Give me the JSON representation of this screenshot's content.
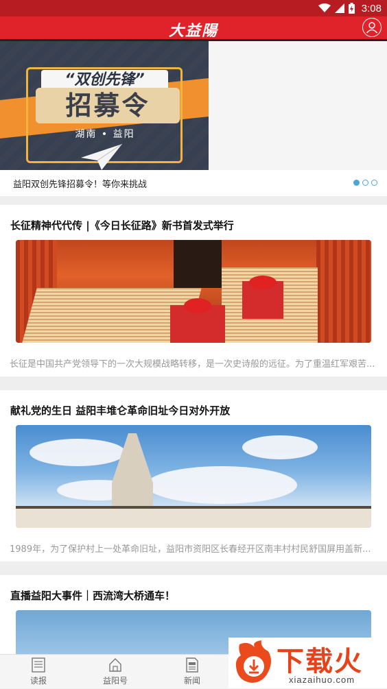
{
  "status_bar": {
    "time": "3:08"
  },
  "header": {
    "logo_text": "大益陽"
  },
  "banner": {
    "top_text": "“双创先锋”",
    "main_text": "招募令",
    "sub_text": "湖南 • 益阳",
    "caption": "益阳双创先锋招募令！等你来挑战",
    "dots": 3,
    "active_dot": 0
  },
  "articles": [
    {
      "title": "长征精神代代传 |《今日长征路》新书首发式举行",
      "summary": "长征是中国共产党领导下的一次大规模战略转移，是一次史诗般的远征。为了重温红军艰苦..."
    },
    {
      "title": "献礼党的生日 益阳丰堆仑革命旧址今日对外开放",
      "summary": "1989年，为了保护村上一处革命旧址，益阳市资阳区长春经开区南丰村村民舒国屏用盖新..."
    },
    {
      "title": "直播益阳大事件｜西流湾大桥通车！",
      "summary": ""
    }
  ],
  "bottom_nav": {
    "items": [
      {
        "label": "读报",
        "icon": "newspaper-icon"
      },
      {
        "label": "益阳号",
        "icon": "home-icon"
      },
      {
        "label": "新闻",
        "icon": "news-doc-icon"
      }
    ]
  },
  "watermark": {
    "text": "下载火",
    "url": "xiazaihuo.com"
  },
  "colors": {
    "brand_red": "#e0222b",
    "dot_blue": "#4aa7d8"
  }
}
